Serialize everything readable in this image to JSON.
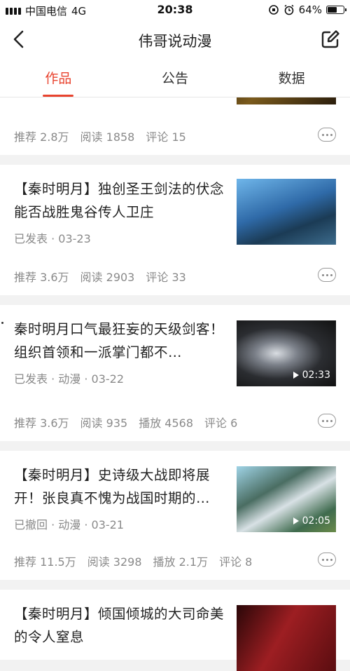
{
  "status_bar": {
    "carrier": "中国电信",
    "network": "4G",
    "time": "20:38",
    "battery_percent": "64%",
    "battery_level": 0.64
  },
  "nav": {
    "title": "伟哥说动漫"
  },
  "tabs": [
    {
      "label": "作品",
      "active": true
    },
    {
      "label": "公告",
      "active": false
    },
    {
      "label": "数据",
      "active": false
    }
  ],
  "articles": [
    {
      "stats": {
        "recommend": "推荐 2.8万",
        "read": "阅读 1858",
        "comment": "评论 15"
      }
    },
    {
      "title": "【秦时明月】独创圣王剑法的伏念 能否战胜鬼谷传人卫庄",
      "meta": "已发表 · 03-23",
      "stats": {
        "recommend": "推荐 3.6万",
        "read": "阅读 2903",
        "comment": "评论 33"
      }
    },
    {
      "title": "秦时明月口气最狂妄的天级剑客！组织首领和一派掌门都不…",
      "meta": "已发表 · 动漫 · 03-22",
      "duration": "02:33",
      "stats": {
        "recommend": "推荐 3.6万",
        "read": "阅读 935",
        "play": "播放 4568",
        "comment": "评论 6"
      }
    },
    {
      "title": "【秦时明月】史诗级大战即将展开！张良真不愧为战国时期的…",
      "meta": "已撤回 · 动漫 · 03-21",
      "duration": "02:05",
      "stats": {
        "recommend": "推荐 11.5万",
        "read": "阅读 3298",
        "play": "播放 2.1万",
        "comment": "评论 8"
      }
    },
    {
      "title": "【秦时明月】倾国倾城的大司命美的令人窒息"
    }
  ],
  "icons": {
    "back": "chevron-left-icon",
    "edit": "edit-icon",
    "more": "more-dots-icon",
    "play": "play-icon"
  },
  "colors": {
    "accent": "#e8432e",
    "muted_text": "#8a8a8a",
    "background": "#f2f2f2"
  }
}
